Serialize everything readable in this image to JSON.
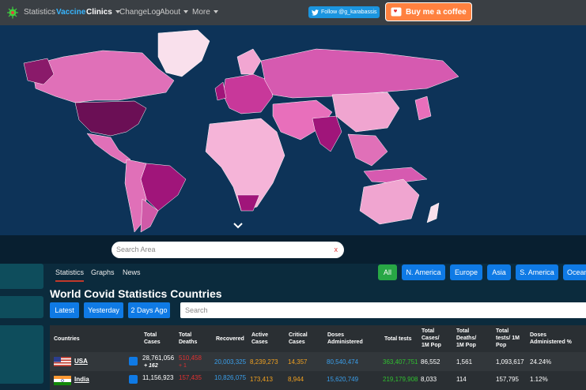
{
  "nav": {
    "items": [
      "Statistics",
      "Vaccine",
      "Clinics",
      "ChangeLog",
      "About",
      "More"
    ],
    "active": "Vaccine",
    "twitter_label": "Follow @g_karabassis",
    "coffee_label": "Buy me a coffee"
  },
  "search_area": {
    "placeholder": "Search Area",
    "clear": "x"
  },
  "tabs": [
    "Statistics",
    "Graphs",
    "News"
  ],
  "regions": [
    "All",
    "N. America",
    "Europe",
    "Asia",
    "S. America",
    "Ocean"
  ],
  "title": "World Covid Statistics Countries",
  "date_buttons": [
    "Latest",
    "Yesterday",
    "2 Days Ago"
  ],
  "table_search": {
    "placeholder": "Search"
  },
  "table": {
    "headers": [
      "Countries",
      "Total Cases",
      "Total Deaths",
      "Recovered",
      "Active Cases",
      "Critical Cases",
      "Doses Administered",
      "Total tests",
      "Total Cases/ 1M Pop",
      "Total Deaths/ 1M Pop",
      "Total tests/ 1M Pop",
      "Doses Administered %"
    ],
    "rows": [
      {
        "country": "USA",
        "total_cases": "28,761,056",
        "new_cases": "+ 162",
        "total_deaths": "510,458",
        "new_deaths": "+ 1",
        "recovered": "20,003,325",
        "active": "8,239,273",
        "critical": "14,357",
        "doses": "80,540,474",
        "tests": "363,407,751",
        "cases_per_m": "86,552",
        "deaths_per_m": "1,561",
        "tests_per_m": "1,093,617",
        "doses_pct": "24.24%"
      },
      {
        "country": "India",
        "total_cases": "11,156,923",
        "new_cases": "",
        "total_deaths": "157,435",
        "new_deaths": "",
        "recovered": "10,826,075",
        "active": "173,413",
        "critical": "8,944",
        "doses": "15,620,749",
        "tests": "219,179,908",
        "cases_per_m": "8,033",
        "deaths_per_m": "114",
        "tests_per_m": "157,795",
        "doses_pct": "1.12%"
      }
    ]
  },
  "colors": {
    "navbar": "#3a3f44",
    "ocean": "#0d3358",
    "accent_blue": "#0f7ae5",
    "green": "#28a745",
    "coffee": "#ff813f",
    "cases_red": "#e03030",
    "recovered_blue": "#3a9eea",
    "active_orange": "#f0a020",
    "tests_green": "#30c030"
  }
}
